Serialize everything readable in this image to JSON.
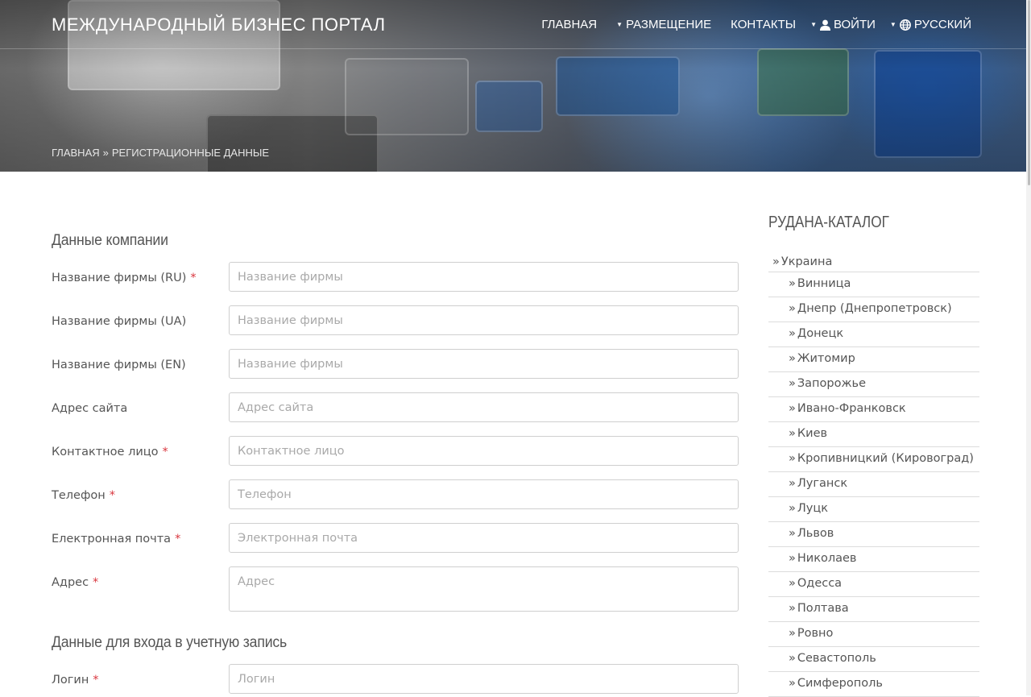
{
  "header": {
    "brand": "МЕЖДУНАРОДНЫЙ БИЗНЕС ПОРТАЛ",
    "nav": [
      {
        "label": "ГЛАВНАЯ"
      },
      {
        "label": "РАЗМЕЩЕНИЕ"
      },
      {
        "label": "КОНТАКТЫ"
      },
      {
        "label": "ВОЙТИ",
        "icon": "user-icon"
      },
      {
        "label": "РУССКИЙ",
        "icon": "globe-icon"
      }
    ],
    "breadcrumb": {
      "home": "ГЛАВНАЯ",
      "separator": "»",
      "current": "РЕГИСТРАЦИОННЫЕ ДАННЫЕ"
    }
  },
  "form": {
    "company_title": "Данные компании",
    "required_mark": "*",
    "fields": [
      {
        "label": "Название фирмы (RU)",
        "placeholder": "Название фирмы",
        "value": "",
        "required": true
      },
      {
        "label": "Название фирмы (UA)",
        "placeholder": "Название фирмы",
        "value": "",
        "required": false
      },
      {
        "label": "Название фирмы (EN)",
        "placeholder": "Название фирмы",
        "value": "",
        "required": false
      },
      {
        "label": "Адрес сайта",
        "placeholder": "Адрес сайта",
        "value": "",
        "required": false
      },
      {
        "label": "Контактное лицо",
        "placeholder": "Контактное лицо",
        "value": "",
        "required": true
      },
      {
        "label": "Телефон",
        "placeholder": "Телефон",
        "value": "",
        "required": true
      },
      {
        "label": "Електронная почта",
        "placeholder": "Электронная почта",
        "value": "",
        "required": true
      },
      {
        "label": "Адрес",
        "placeholder": "Адрес",
        "value": "",
        "required": true
      }
    ],
    "login_title": "Данные для входа в учетную запись",
    "login_field": {
      "label": "Логин",
      "placeholder": "Логин",
      "value": "",
      "required": true
    }
  },
  "sidebar": {
    "title": "РУДАНА-КАТАЛОГ",
    "marker": "»",
    "root": "Украина",
    "items": [
      "Винница",
      "Днепр (Днепропетровск)",
      "Донецк",
      "Житомир",
      "Запорожье",
      "Ивано-Франковск",
      "Киев",
      "Кропивницкий (Кировоград)",
      "Луганск",
      "Луцк",
      "Львов",
      "Николаев",
      "Одесса",
      "Полтава",
      "Ровно",
      "Севастополь",
      "Симферополь"
    ]
  }
}
